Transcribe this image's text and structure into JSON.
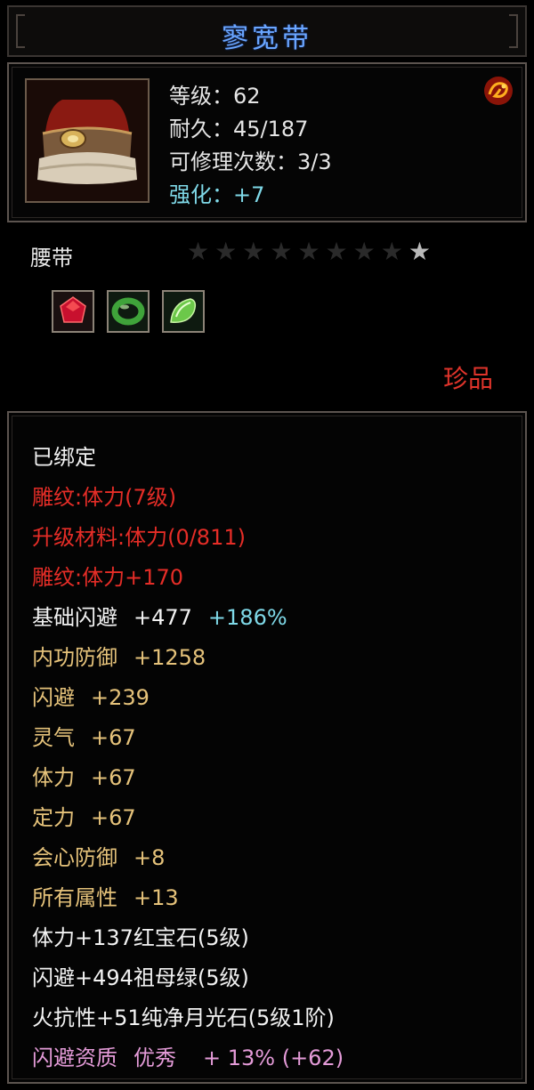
{
  "title": "寥宽带",
  "header": {
    "level_label": "等级：62",
    "durability_label": "耐久：45/187",
    "repair_label": "可修理次数：3/3",
    "strength_label": "强化：+7",
    "badge_icon": "fire-dragon-badge-icon",
    "item_icon": "belt-icon"
  },
  "item_type": "腰带",
  "stars": {
    "total": 9,
    "lit": 1
  },
  "gems": [
    {
      "name": "ruby-gem-icon",
      "color": "#c8102e"
    },
    {
      "name": "emerald-ring-gem-icon",
      "color": "#3fa33a"
    },
    {
      "name": "moonstone-gem-icon",
      "color": "#6cc84a"
    }
  ],
  "rarity": "珍品",
  "attributes": {
    "bound": "已绑定",
    "engrave": "雕纹:体力(7级)",
    "upgrade_material": "升级材料:体力(0/811)",
    "engrave_bonus": "雕纹:体力+170",
    "base_dodge": {
      "name": "基础闪避",
      "value": "+477",
      "bonus": "+186%"
    },
    "internal_defense": {
      "name": "内功防御",
      "value": "+1258"
    },
    "dodge": {
      "name": "闪避",
      "value": "+239"
    },
    "spirit": {
      "name": "灵气",
      "value": "+67"
    },
    "stamina": {
      "name": "体力",
      "value": "+67"
    },
    "focus": {
      "name": "定力",
      "value": "+67"
    },
    "crit_defense": {
      "name": "会心防御",
      "value": "+8"
    },
    "all_attributes": {
      "name": "所有属性",
      "value": "+13"
    },
    "gem_line_1": "体力+137红宝石(5级)",
    "gem_line_2": "闪避+494祖母绿(5级)",
    "gem_line_3": "火抗性+51纯净月光石(5级1阶)",
    "aptitude": {
      "name": "闪避资质",
      "grade": "优秀",
      "value": "+ 13% (+62)"
    }
  },
  "colors": {
    "title": "#6aa6ff",
    "rarity": "#e0342b",
    "red_text": "#e52d27",
    "gold_text": "#e5c27a",
    "cyan_text": "#7fd9e8",
    "pink_text": "#e49bd8"
  }
}
